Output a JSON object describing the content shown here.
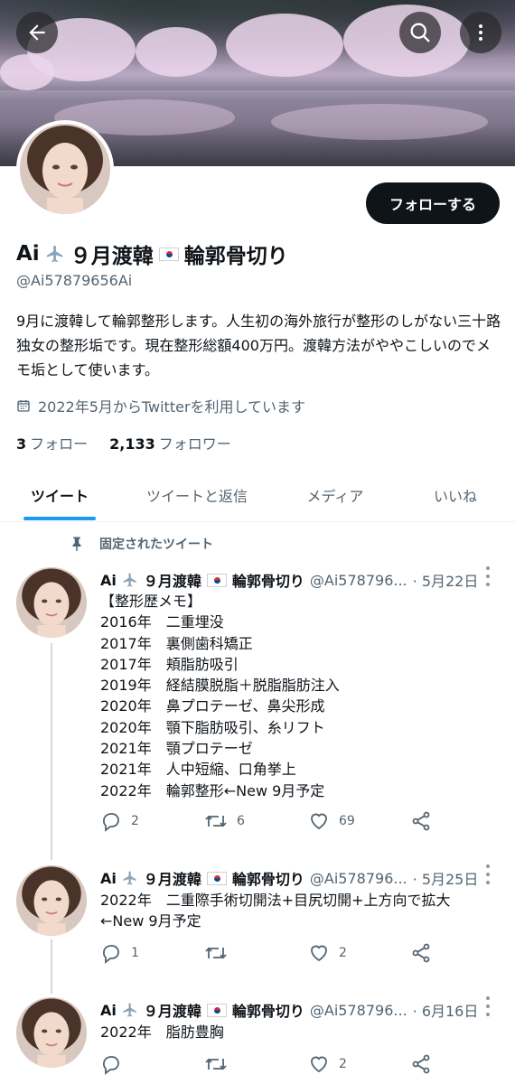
{
  "profile": {
    "name_part1": "Ai",
    "name_part2": "９月渡韓",
    "name_part3": "輪郭骨切り",
    "handle": "@Ai57879656Ai",
    "follow_label": "フォローする",
    "bio": "9月に渡韓して輪郭整形します。人生初の海外旅行が整形のしがない三十路独女の整形垢です。現在整形総額400万円。渡韓方法がややこしいのでメモ垢として使います。",
    "joined": "2022年5月からTwitterを利用しています",
    "following_count": "3",
    "following_label": "フォロー",
    "followers_count": "2,133",
    "followers_label": "フォロワー"
  },
  "tabs": [
    {
      "label": "ツイート"
    },
    {
      "label": "ツイートと返信"
    },
    {
      "label": "メディア"
    },
    {
      "label": "いいね"
    }
  ],
  "pinned_label": "固定されたツイート",
  "tweets": [
    {
      "name_part1": "Ai",
      "name_part2": "９月渡韓",
      "name_part3": "輪郭骨切り",
      "handle": "@Ai578796...",
      "date": "· 5月22日",
      "lines": [
        "【整形歴メモ】",
        "2016年　二重埋没",
        "2017年　裏側歯科矯正",
        "2017年　頬脂肪吸引",
        "2019年　経結膜脱脂＋脱脂脂肪注入",
        "2020年　鼻プロテーゼ、鼻尖形成",
        "2020年　顎下脂肪吸引、糸リフト",
        "2021年　顎プロテーゼ",
        "2021年　人中短縮、口角挙上",
        "2022年　輪郭整形←New 9月予定"
      ],
      "replies": "2",
      "retweets": "6",
      "likes": "69"
    },
    {
      "name_part1": "Ai",
      "name_part2": "９月渡韓",
      "name_part3": "輪郭骨切り",
      "handle": "@Ai578796...",
      "date": "· 5月25日",
      "lines": [
        "2022年　二重際手術切開法+目尻切開+上方向で拡大",
        "←New 9月予定"
      ],
      "replies": "1",
      "retweets": "",
      "likes": "2"
    },
    {
      "name_part1": "Ai",
      "name_part2": "９月渡韓",
      "name_part3": "輪郭骨切り",
      "handle": "@Ai578796...",
      "date": "· 6月16日",
      "lines": [
        "2022年　脂肪豊胸"
      ],
      "replies": "",
      "retweets": "",
      "likes": "2"
    }
  ],
  "icons": {
    "back": "arrow-left-icon",
    "search": "search-icon",
    "more": "more-vertical-icon",
    "calendar": "calendar-icon",
    "pin": "pin-icon",
    "reply": "reply-icon",
    "retweet": "retweet-icon",
    "like": "heart-icon",
    "share": "share-icon"
  },
  "colors": {
    "accent": "#1d9bf0",
    "text": "#0f1419",
    "muted": "#536471"
  }
}
